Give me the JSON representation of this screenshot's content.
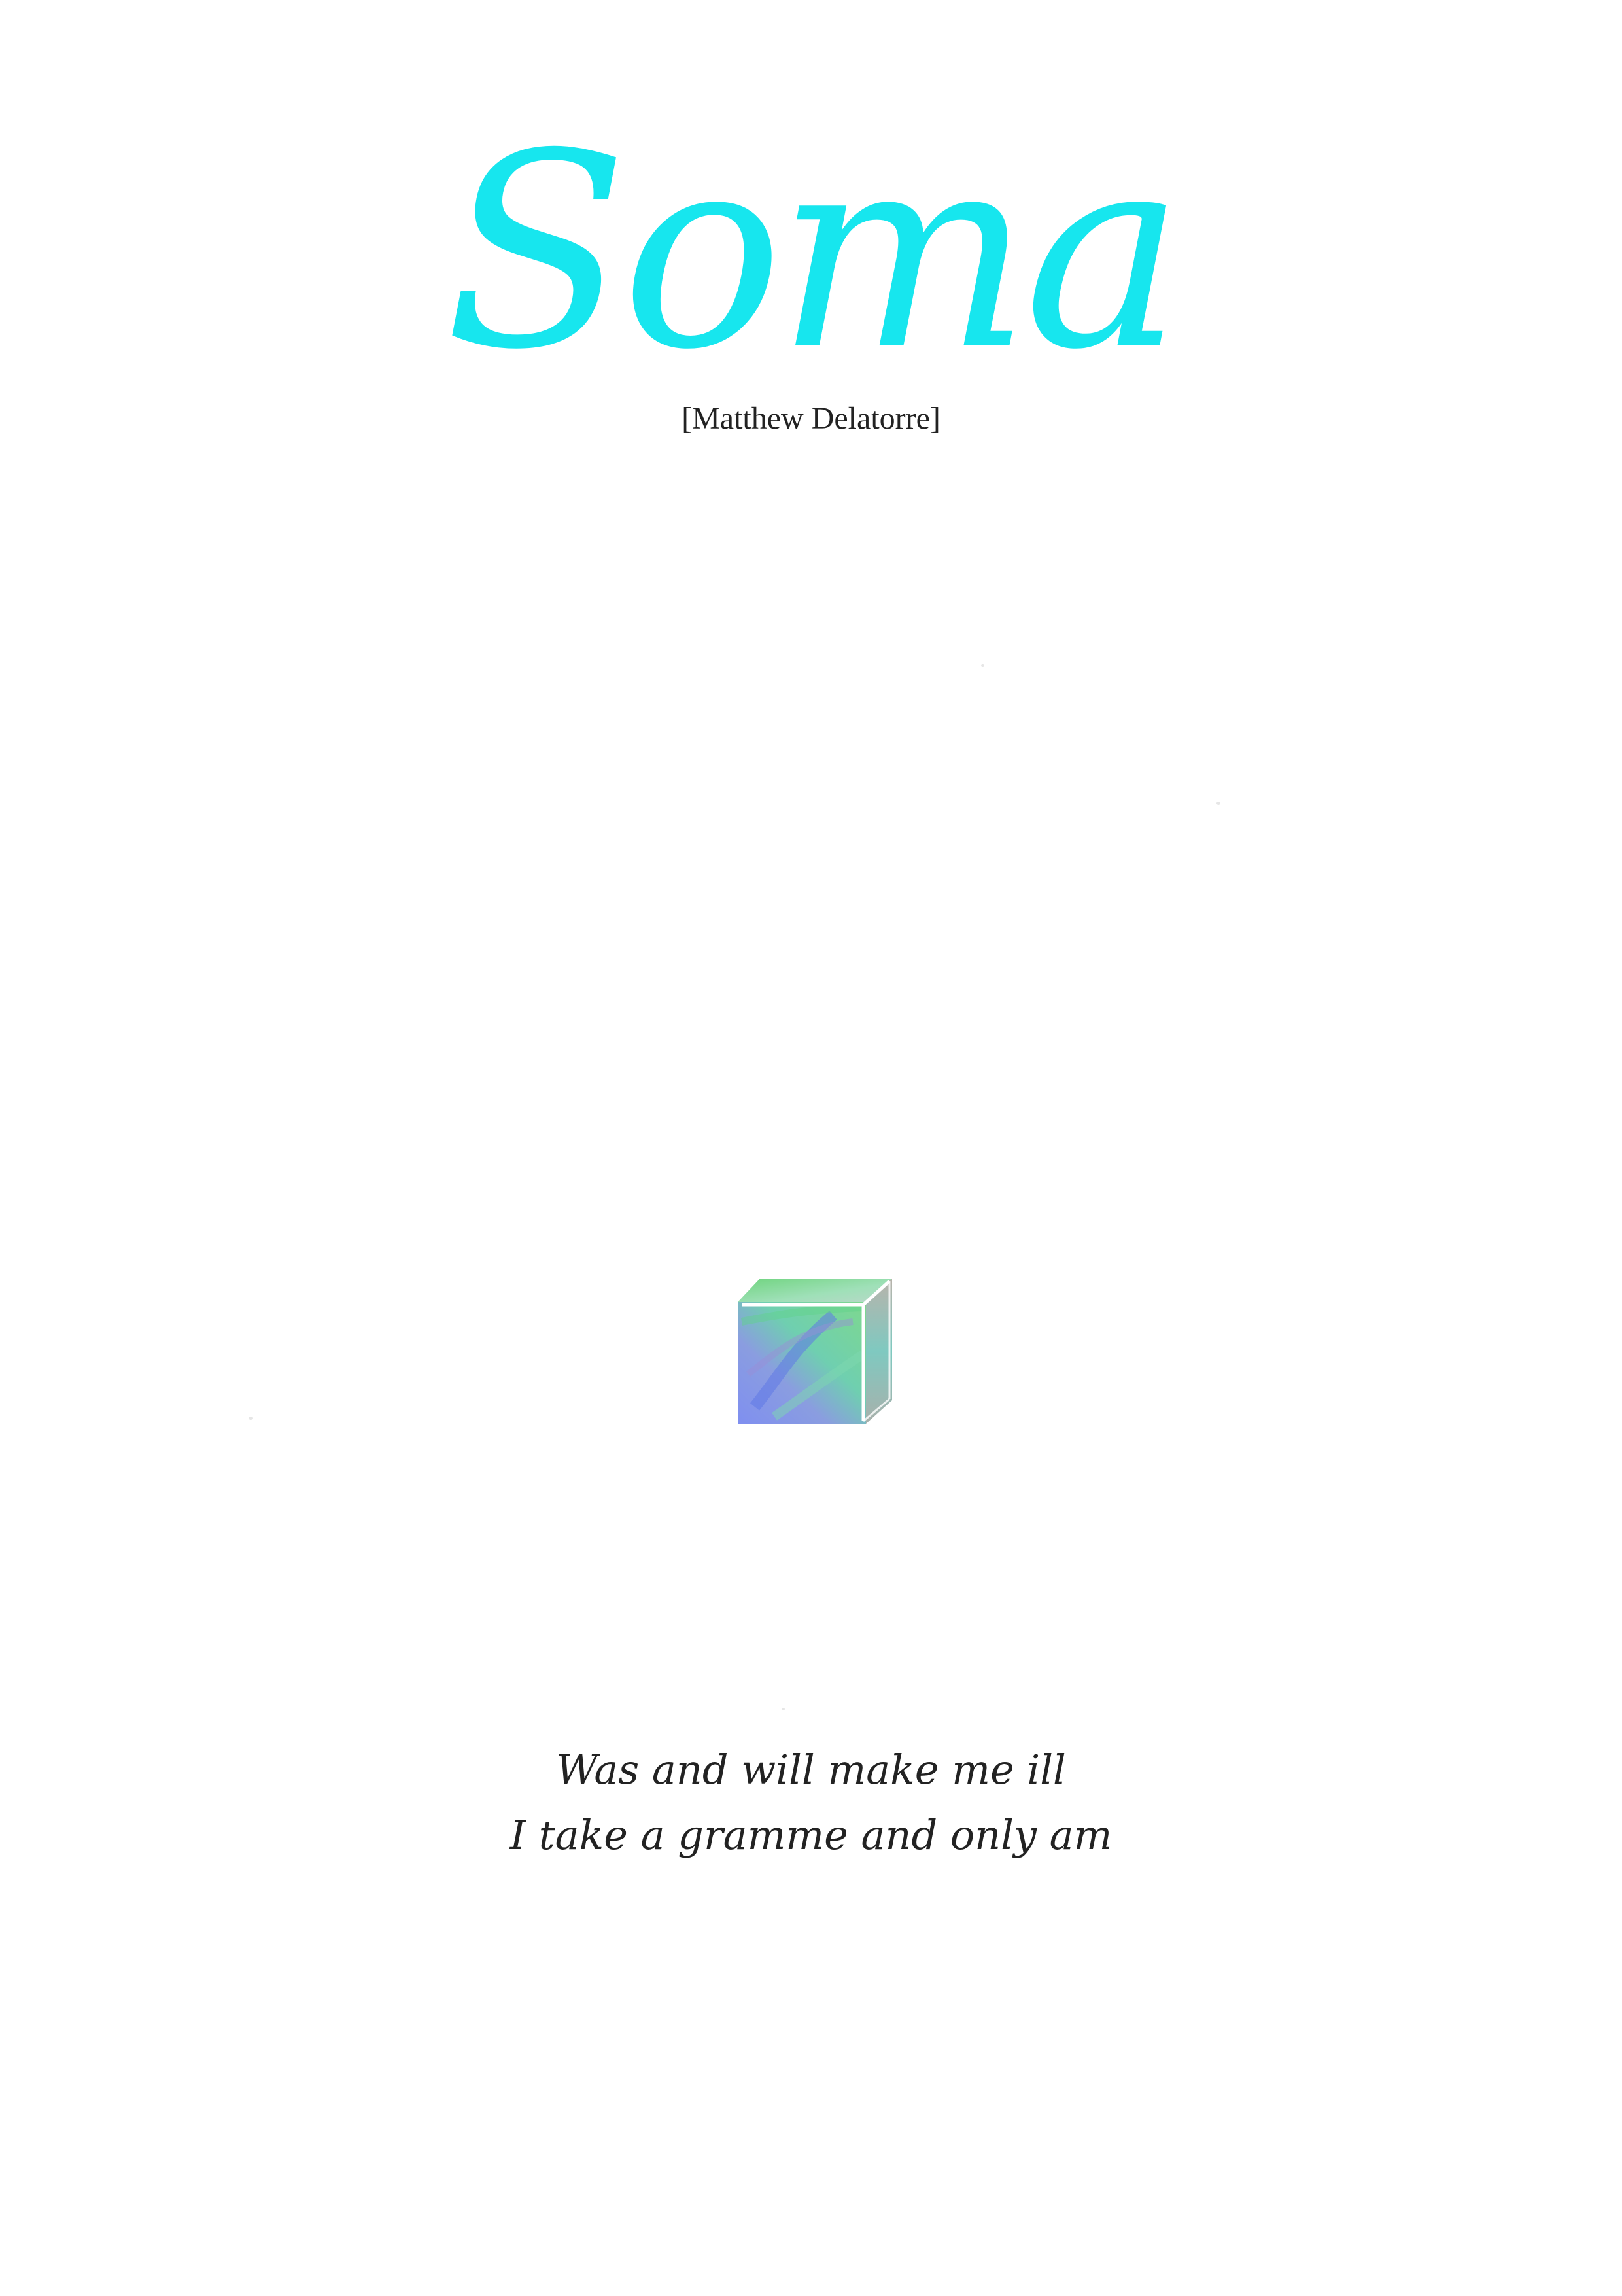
{
  "title": "Soma",
  "author": "[Matthew Delatorre]",
  "poem": {
    "lines": [
      "Was and will make me ill",
      "I take a gramme and only am"
    ]
  },
  "illustration": {
    "icon": "soma-cube-icon",
    "colors": {
      "front_blue": "#7f93e8",
      "front_green": "#6fd69a",
      "top": "#8fe0a8",
      "side": "#b3aea6",
      "edge": "#ffffff"
    }
  },
  "colors": {
    "title": "#17e6ee",
    "text": "#222222",
    "background": "#ffffff"
  }
}
